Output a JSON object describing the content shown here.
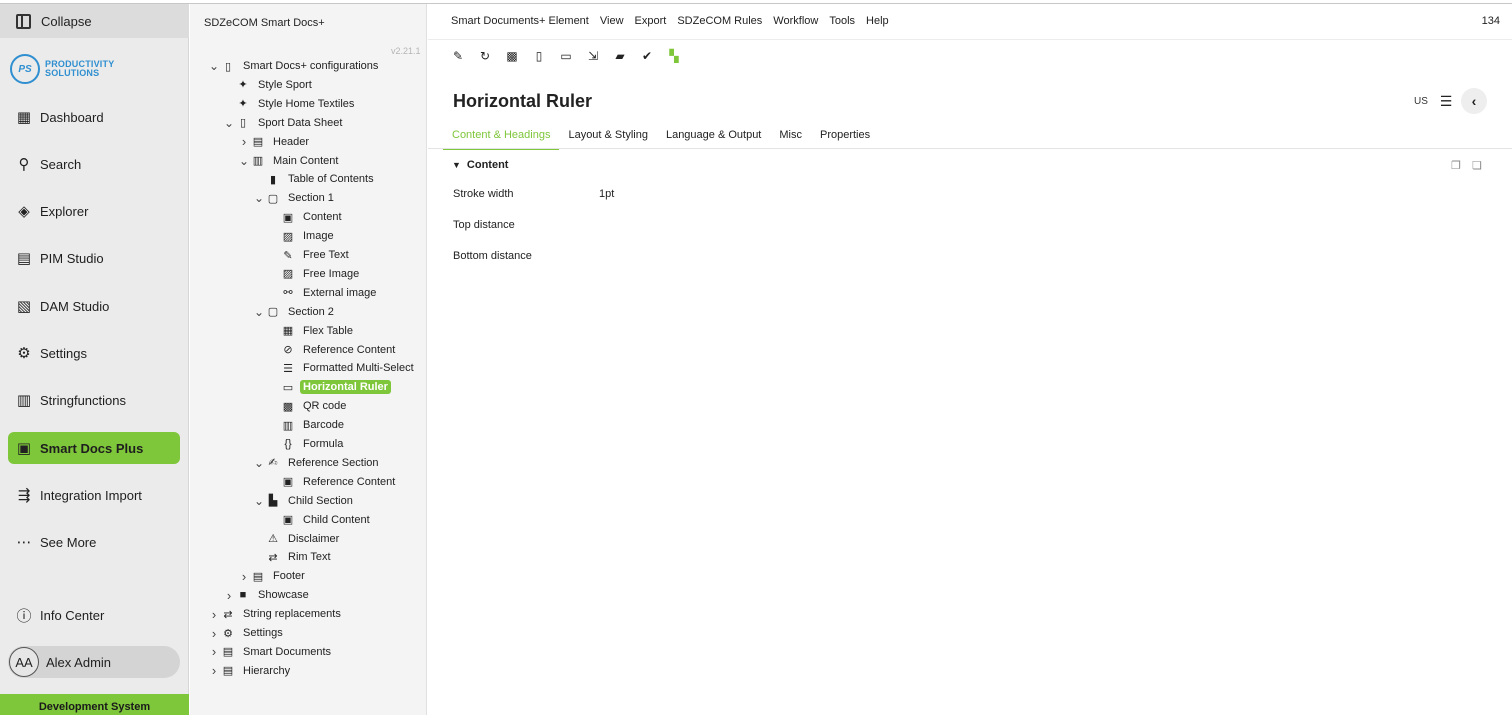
{
  "nav": {
    "collapse_label": "Collapse",
    "logo": {
      "initials": "PS",
      "line1": "PRODUCTIVITY",
      "line2": "SOLUTIONS"
    },
    "items": [
      {
        "label": "Dashboard",
        "icon": "dashboard-icon"
      },
      {
        "label": "Search",
        "icon": "search-icon"
      },
      {
        "label": "Explorer",
        "icon": "explorer-icon"
      },
      {
        "label": "PIM Studio",
        "icon": "pim-icon"
      },
      {
        "label": "DAM Studio",
        "icon": "image-icon"
      },
      {
        "label": "Settings",
        "icon": "gear-icon"
      },
      {
        "label": "Stringfunctions",
        "icon": "calculator-icon"
      },
      {
        "label": "Smart Docs Plus",
        "icon": "document-icon",
        "active": true
      },
      {
        "label": "Integration Import",
        "icon": "import-icon"
      },
      {
        "label": "See More",
        "icon": "more-icon"
      }
    ],
    "info_center": "Info Center",
    "user": {
      "initials": "AA",
      "name": "Alex Admin"
    },
    "environment": "Development System",
    "accent": "#7ec63a"
  },
  "tree": {
    "title": "SDZeCOM Smart Docs+",
    "version": "v2.21.1",
    "nodes": [
      {
        "label": "Smart Docs+ configurations",
        "chevron": "v",
        "icon": "pdf-icon"
      },
      {
        "label": "Style Sport",
        "chevron": "",
        "icon": "style-icon"
      },
      {
        "label": "Style Home Textiles",
        "chevron": "",
        "icon": "style-icon"
      },
      {
        "label": "Sport Data Sheet",
        "chevron": "v",
        "icon": "pdf-icon"
      },
      {
        "label": "Header",
        "chevron": ">",
        "icon": "header-icon"
      },
      {
        "label": "Main Content",
        "chevron": "v",
        "icon": "main-content-icon"
      },
      {
        "label": "Table of Contents",
        "chevron": "",
        "icon": "bookmark-icon"
      },
      {
        "label": "Section 1",
        "chevron": "v",
        "icon": "section-icon"
      },
      {
        "label": "Content",
        "chevron": "",
        "icon": "content-icon"
      },
      {
        "label": "Image",
        "chevron": "",
        "icon": "image-icon"
      },
      {
        "label": "Free Text",
        "chevron": "",
        "icon": "pen-icon"
      },
      {
        "label": "Free Image",
        "chevron": "",
        "icon": "image-icon"
      },
      {
        "label": "External image",
        "chevron": "",
        "icon": "link-icon"
      },
      {
        "label": "Section 2",
        "chevron": "v",
        "icon": "section-icon"
      },
      {
        "label": "Flex Table",
        "chevron": "",
        "icon": "table-icon"
      },
      {
        "label": "Reference Content",
        "chevron": "",
        "icon": "reference-icon"
      },
      {
        "label": "Formatted Multi-Select",
        "chevron": "",
        "icon": "list-icon"
      },
      {
        "label": "Horizontal Ruler",
        "chevron": "",
        "icon": "ruler-icon",
        "selected": true
      },
      {
        "label": "QR code",
        "chevron": "",
        "icon": "qr-icon"
      },
      {
        "label": "Barcode",
        "chevron": "",
        "icon": "barcode-icon"
      },
      {
        "label": "Formula",
        "chevron": "",
        "icon": "formula-icon"
      },
      {
        "label": "Reference Section",
        "chevron": "v",
        "icon": "reference-section-icon"
      },
      {
        "label": "Reference Content",
        "chevron": "",
        "icon": "content-icon"
      },
      {
        "label": "Child Section",
        "chevron": "v",
        "icon": "child-section-icon"
      },
      {
        "label": "Child Content",
        "chevron": "",
        "icon": "content-icon"
      },
      {
        "label": "Disclaimer",
        "chevron": "",
        "icon": "disclaimer-icon"
      },
      {
        "label": "Rim Text",
        "chevron": "",
        "icon": "rim-text-icon"
      },
      {
        "label": "Footer",
        "chevron": ">",
        "icon": "footer-icon"
      },
      {
        "label": "Showcase",
        "chevron": ">",
        "icon": "folder-icon"
      },
      {
        "label": "String replacements",
        "chevron": ">",
        "icon": "swap-icon"
      },
      {
        "label": "Settings",
        "chevron": ">",
        "icon": "gear-icon"
      },
      {
        "label": "Smart Documents",
        "chevron": ">",
        "icon": "document-icon"
      },
      {
        "label": "Hierarchy",
        "chevron": ">",
        "icon": "database-icon"
      }
    ]
  },
  "main": {
    "menu": [
      "Smart Documents+ Element",
      "View",
      "Export",
      "SDZeCOM Rules",
      "Workflow",
      "Tools",
      "Help"
    ],
    "counter": "134",
    "toolbar": [
      {
        "icon": "edit-icon"
      },
      {
        "icon": "reload-icon"
      },
      {
        "icon": "preview-icon"
      },
      {
        "icon": "pdf-icon"
      },
      {
        "icon": "pdf-settings-icon"
      },
      {
        "icon": "export-icon"
      },
      {
        "icon": "briefcase-icon"
      },
      {
        "icon": "check-circle-icon"
      },
      {
        "icon": "hierarchy-icon"
      }
    ],
    "title": "Horizontal Ruler",
    "locale": "US",
    "tabs": [
      "Content & Headings",
      "Layout & Styling",
      "Language & Output",
      "Misc",
      "Properties"
    ],
    "active_tab": 0,
    "section": {
      "title": "Content",
      "fields": [
        {
          "label": "Stroke width",
          "value": "1pt"
        },
        {
          "label": "Top distance",
          "value": ""
        },
        {
          "label": "Bottom distance",
          "value": ""
        }
      ]
    }
  }
}
